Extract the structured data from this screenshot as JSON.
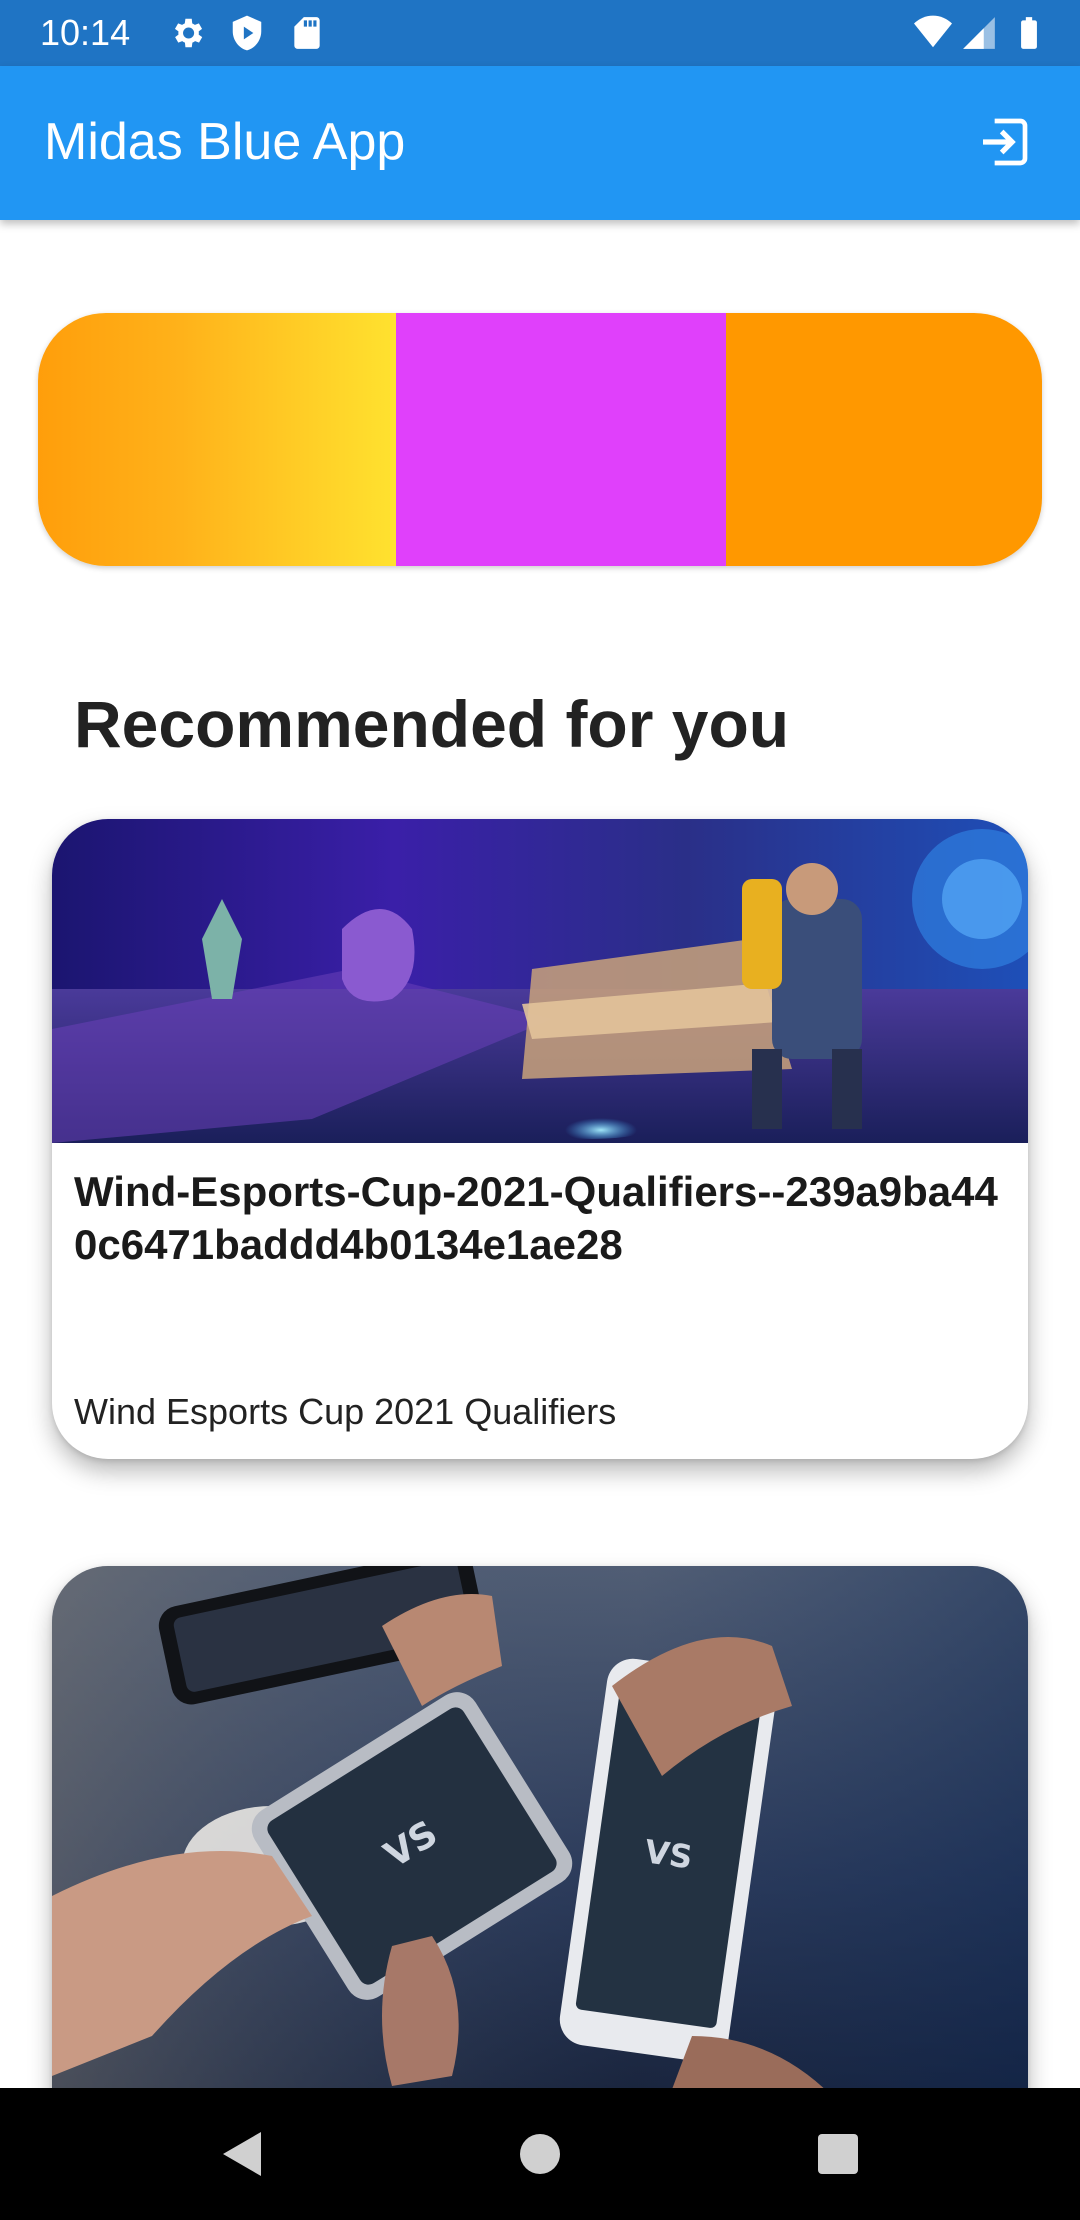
{
  "status_bar": {
    "time": "10:14",
    "icons_left": [
      "gear-icon",
      "shield-icon",
      "sd-card-icon"
    ],
    "icons_right": [
      "wifi-icon",
      "signal-icon",
      "battery-icon"
    ]
  },
  "app_bar": {
    "title": "Midas Blue App",
    "action_icon": "logout-icon"
  },
  "banner": {
    "colors": [
      "#ffa000",
      "#ffe22f",
      "#e040fb",
      "#ff9800"
    ]
  },
  "section": {
    "title": "Recommended for you"
  },
  "cards": [
    {
      "title": "Wind-Esports-Cup-2021-Qualifiers--239a9ba440c6471baddd4b0134e1ae28",
      "subtitle": "Wind Esports Cup 2021 Qualifiers",
      "image": "fortnite-artwork"
    },
    {
      "image": "mobile-gaming-hands-photo"
    }
  ],
  "nav_bar": {
    "buttons": [
      "back-icon",
      "home-icon",
      "recents-icon"
    ]
  },
  "colors": {
    "status_bar": "#1f74c4",
    "app_bar": "#2196f3",
    "nav_bar": "#000000"
  }
}
